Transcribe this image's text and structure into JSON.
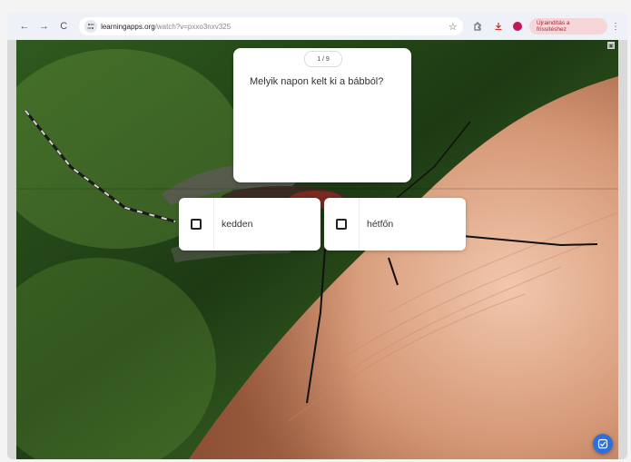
{
  "browser": {
    "nav": {
      "back_icon": "←",
      "forward_icon": "→",
      "reload_icon": "C"
    },
    "url": {
      "host": "learningapps.org",
      "path": "/watch?v=pxxo3nxv325"
    },
    "update_button_label": "Újraindítás a frissítéshez",
    "icons": {
      "star": "star-icon",
      "extensions": "extensions-icon",
      "download": "download-icon",
      "profile": "profile-icon",
      "more": "more-icon"
    }
  },
  "quiz": {
    "counter": "1 / 9",
    "question": "Melyik napon kelt ki a bábból?",
    "answers": [
      {
        "label": "kedden"
      },
      {
        "label": "hétfőn"
      }
    ]
  },
  "colors": {
    "accent": "#2f6fd6",
    "update_bg": "#f7d6d8",
    "update_text": "#a4243b"
  }
}
